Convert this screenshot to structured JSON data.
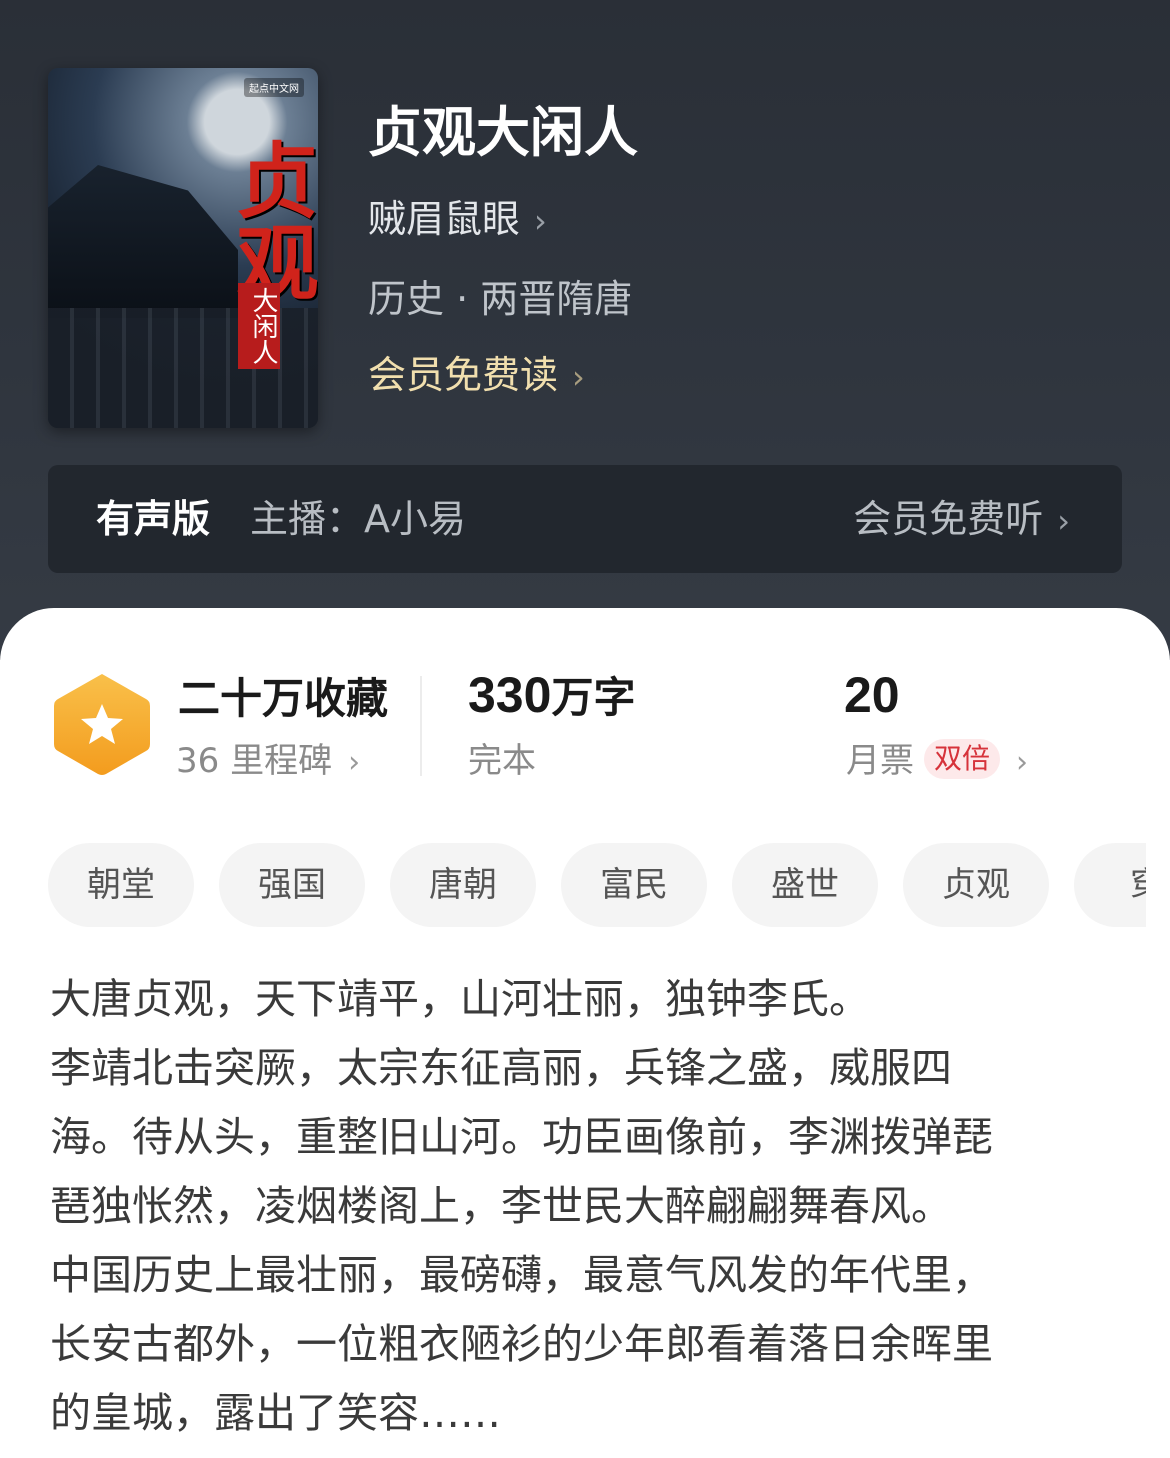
{
  "book": {
    "title": "贞观大闲人",
    "author": "贼眉鼠眼",
    "genre": "历史 · 两晋隋唐",
    "vip_read": "会员免费读",
    "cover": {
      "logo_text": "起点中文网",
      "title_big": "贞观",
      "title_small": "大闲人"
    }
  },
  "audio": {
    "tag": "有声版",
    "host_label": "主播：",
    "host_name": "A小易",
    "vip_listen": "会员免费听"
  },
  "stats": {
    "collect": "二十万收藏",
    "milestone": "36 里程碑",
    "words_num": "330",
    "words_unit": "万字",
    "status": "完本",
    "monthly_votes": "20",
    "monthly_label": "月票",
    "double_badge": "双倍"
  },
  "tags": [
    "朝堂",
    "强国",
    "唐朝",
    "富民",
    "盛世",
    "贞观",
    "穿"
  ],
  "description": [
    "大唐贞观，天下靖平，山河壮丽，独钟李氏。",
    "李靖北击突厥，太宗东征高丽，兵锋之盛，威服四",
    "海。待从头，重整旧山河。功臣画像前，李渊拨弹琵",
    "琶独怅然，凌烟楼阁上，李世民大醉翩翩舞春风。",
    "中国历史上最壮丽，最磅礴，最意气风发的年代里，",
    "长安古都外，一位粗衣陋衫的少年郎看着落日余晖里",
    "的皇城，露出了笑容……"
  ],
  "colors": {
    "hero_bg": "#2f353e",
    "vip_gold": "#f1dfae",
    "badge_orange": "#f5a623",
    "double_red": "#d6333b"
  },
  "icons": [
    "chevron-right-icon",
    "star-badge-icon"
  ]
}
